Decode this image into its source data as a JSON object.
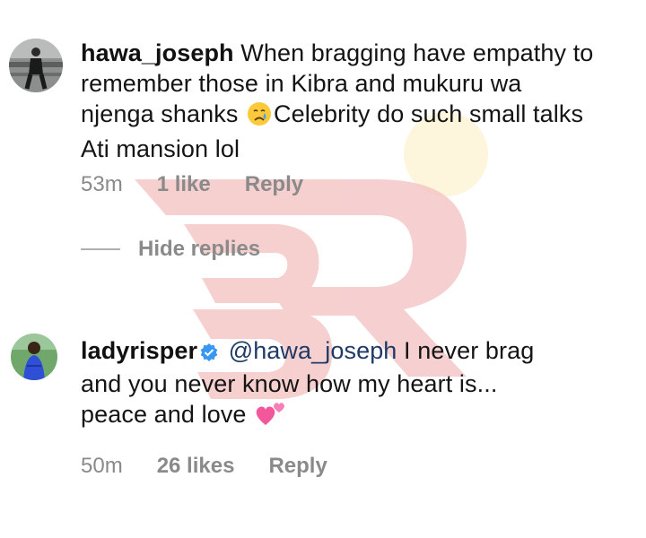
{
  "comments": [
    {
      "username": "hawa_joseph",
      "lines": [
        "When bragging have empathy to",
        "remember those in Kibra and mukuru wa",
        "njenga shanks",
        "Celebrity do such small talks",
        "Ati mansion lol"
      ],
      "emoji": "crying-face-emoji",
      "time": "53m",
      "likes": "1 like",
      "reply_label": "Reply"
    },
    {
      "username": "ladyrisper",
      "verified": true,
      "mention": "@hawa_joseph",
      "lines": [
        "I never brag",
        "and you never know how my heart is...",
        "peace and love"
      ],
      "emoji": "two-hearts-emoji",
      "time": "50m",
      "likes": "26 likes",
      "reply_label": "Reply"
    }
  ],
  "replies_toggle": {
    "label": "Hide replies"
  },
  "colors": {
    "text": "#141414",
    "meta": "#8a8a8a",
    "mention": "#1f3a66",
    "verified": "#3897f0",
    "watermark": "#e86a6a"
  }
}
